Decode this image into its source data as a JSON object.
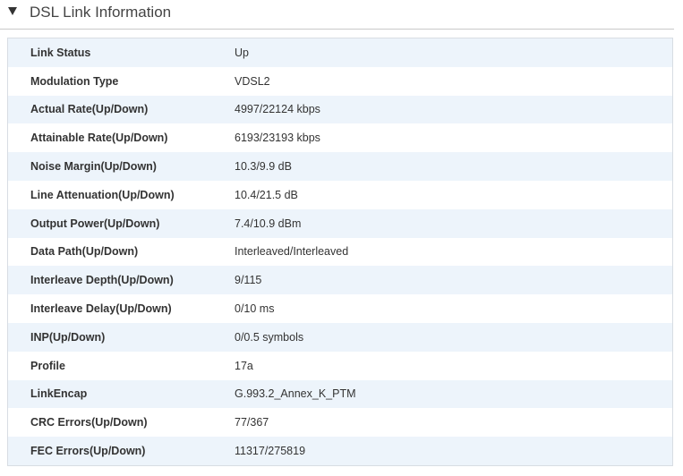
{
  "section": {
    "title": "DSL Link Information",
    "toggle_icon": "triangle-down-icon"
  },
  "rows": [
    {
      "label": "Link Status",
      "value": "Up"
    },
    {
      "label": "Modulation Type",
      "value": "VDSL2"
    },
    {
      "label": "Actual Rate(Up/Down)",
      "value": "4997/22124 kbps"
    },
    {
      "label": "Attainable Rate(Up/Down)",
      "value": "6193/23193 kbps"
    },
    {
      "label": "Noise Margin(Up/Down)",
      "value": "10.3/9.9 dB"
    },
    {
      "label": "Line Attenuation(Up/Down)",
      "value": "10.4/21.5 dB"
    },
    {
      "label": "Output Power(Up/Down)",
      "value": "7.4/10.9 dBm"
    },
    {
      "label": "Data Path(Up/Down)",
      "value": "Interleaved/Interleaved"
    },
    {
      "label": "Interleave Depth(Up/Down)",
      "value": "9/115"
    },
    {
      "label": "Interleave Delay(Up/Down)",
      "value": "0/10 ms"
    },
    {
      "label": "INP(Up/Down)",
      "value": "0/0.5 symbols"
    },
    {
      "label": "Profile",
      "value": "17a"
    },
    {
      "label": "LinkEncap",
      "value": "G.993.2_Annex_K_PTM"
    },
    {
      "label": "CRC Errors(Up/Down)",
      "value": "77/367"
    },
    {
      "label": "FEC Errors(Up/Down)",
      "value": "11317/275819"
    }
  ],
  "colors": {
    "row_alt": "#edf4fb",
    "row_plain": "#ffffff",
    "border": "#d8dde3",
    "text": "#333333"
  }
}
